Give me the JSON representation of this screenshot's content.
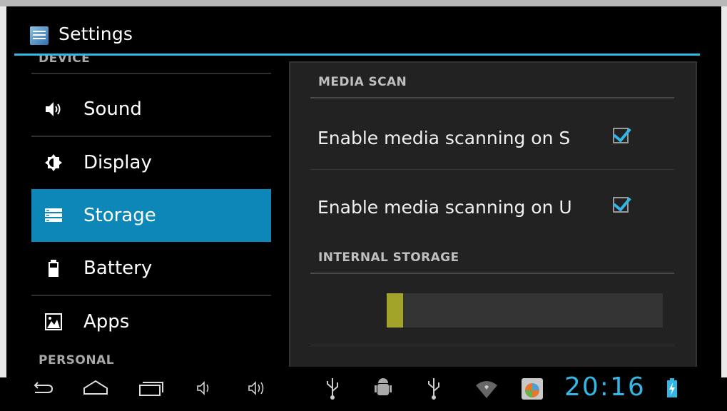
{
  "app": {
    "title": "Settings"
  },
  "sidebar": {
    "section_device": "DEVICE",
    "section_personal": "PERSONAL",
    "items": [
      {
        "label": "Sound",
        "icon": "speaker-icon",
        "selected": false
      },
      {
        "label": "Display",
        "icon": "brightness-icon",
        "selected": false
      },
      {
        "label": "Storage",
        "icon": "storage-icon",
        "selected": true
      },
      {
        "label": "Battery",
        "icon": "battery-icon",
        "selected": false
      },
      {
        "label": "Apps",
        "icon": "apps-icon",
        "selected": false
      }
    ]
  },
  "detail": {
    "media_scan_header": "MEDIA SCAN",
    "media_scan_sd": {
      "label": "Enable media scanning on SD",
      "checked": true
    },
    "media_scan_usb": {
      "label": "Enable media scanning on USB",
      "checked": true
    },
    "internal_storage_header": "INTERNAL STORAGE",
    "internal_storage_used_fraction": 0.06
  },
  "systembar": {
    "clock": "20:16",
    "accent": "#33b5e5"
  },
  "colors": {
    "selected_item": "#0d86b8",
    "accent": "#33b5e5",
    "storage_fill": "#a2a429"
  }
}
